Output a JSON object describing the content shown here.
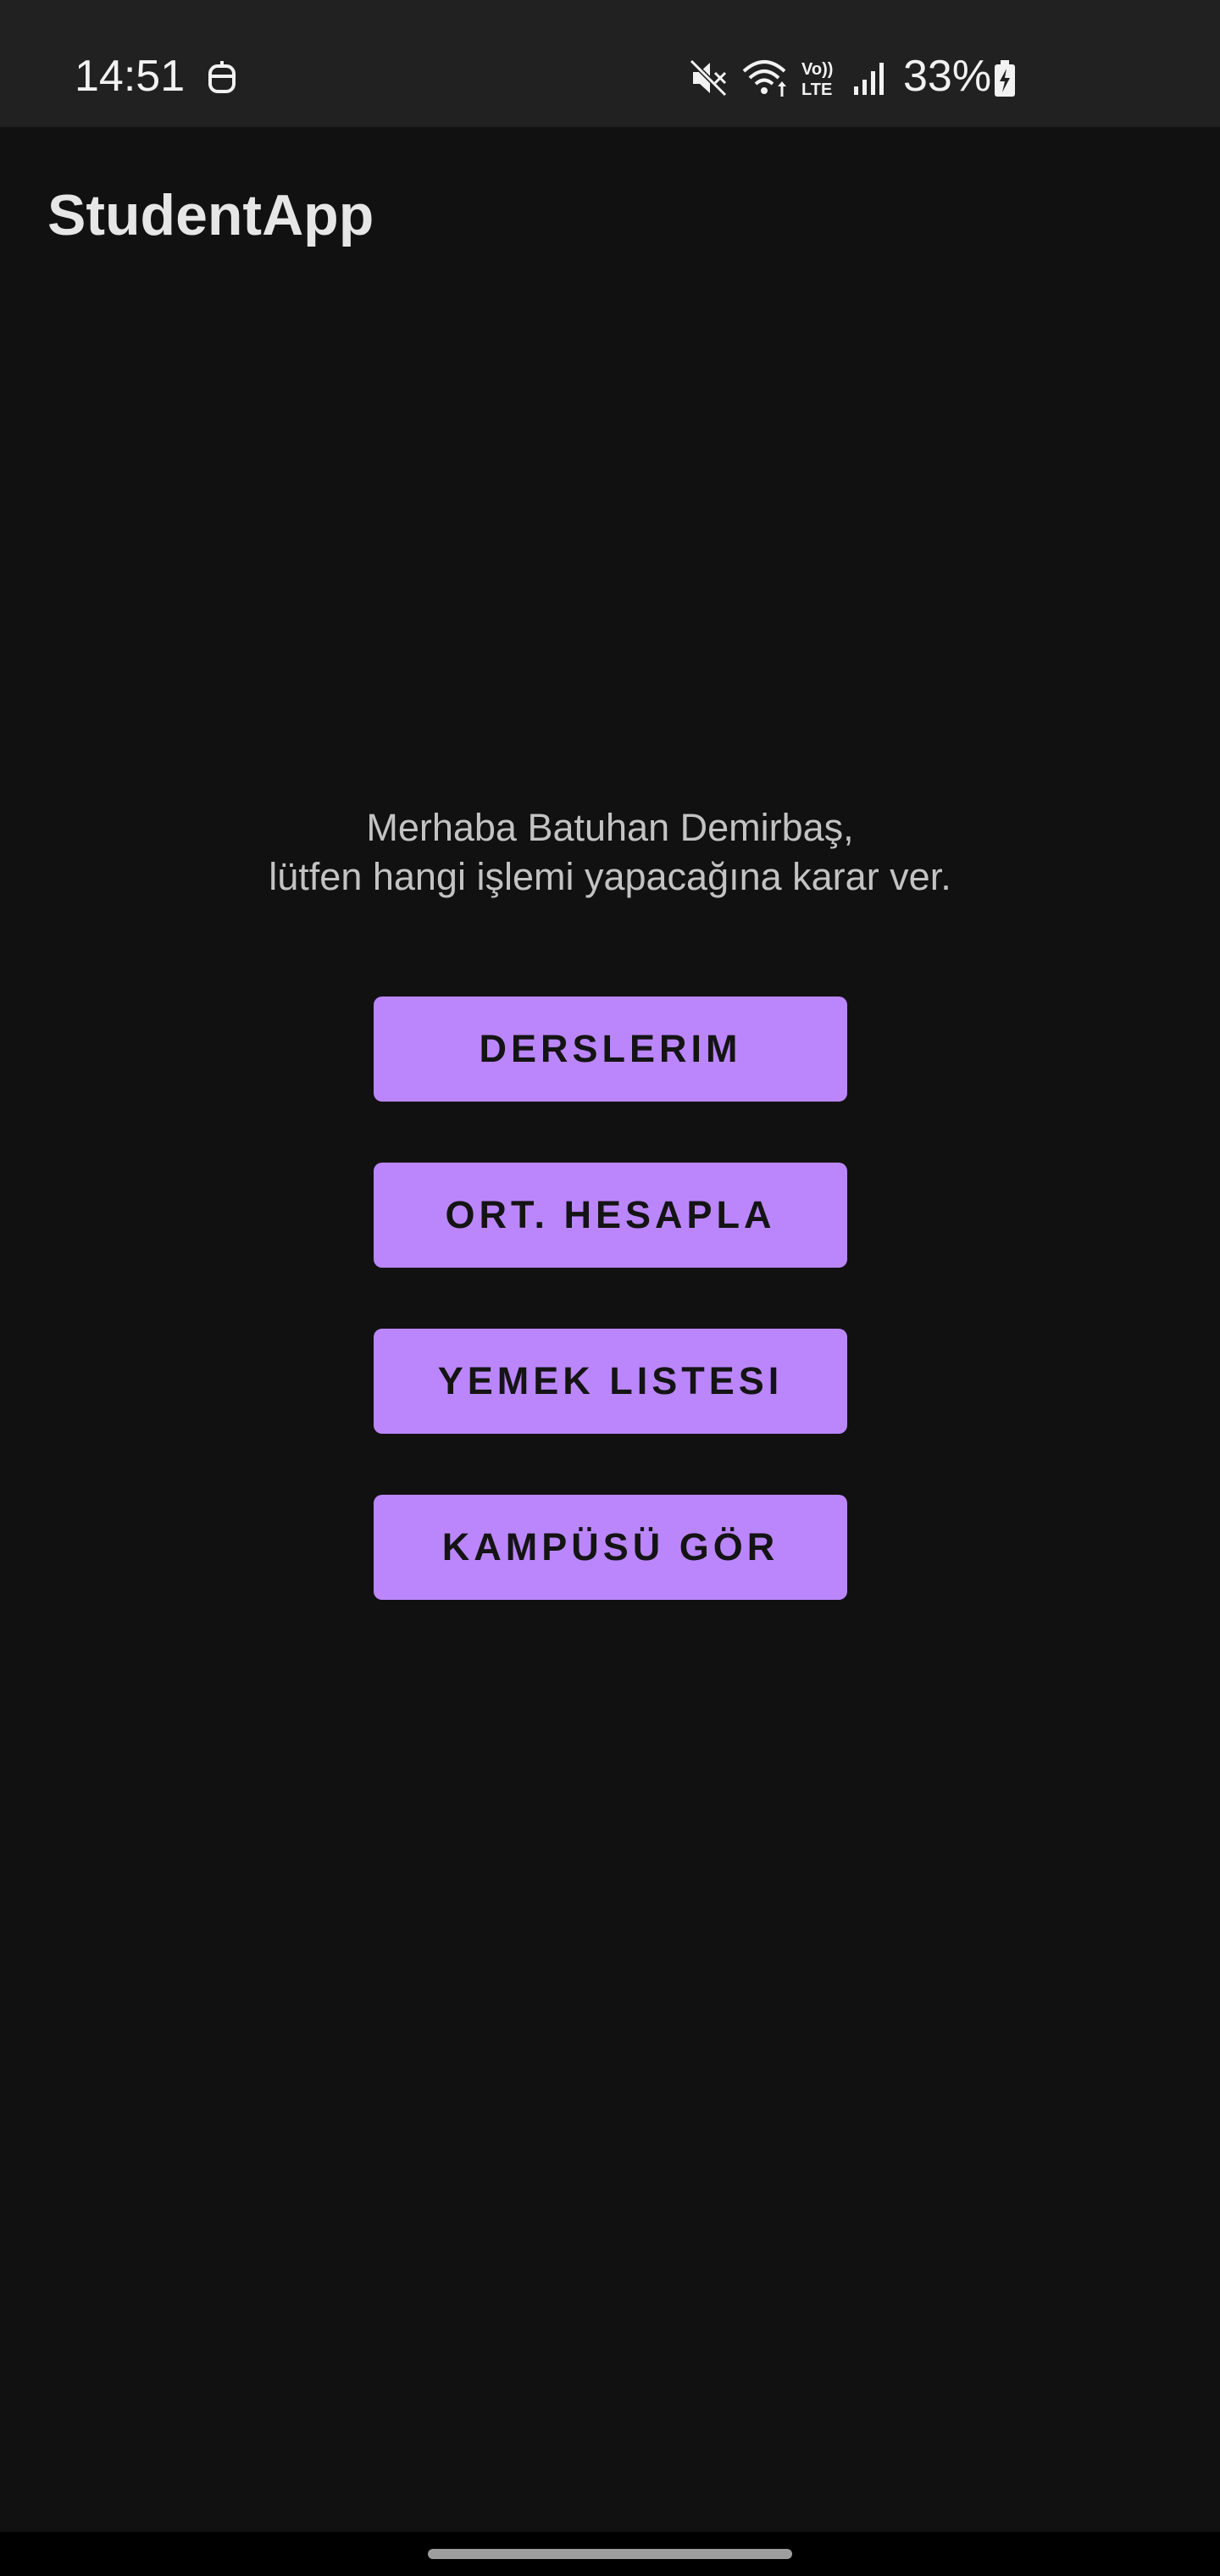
{
  "status_bar": {
    "time": "14:51",
    "battery_percent": "33%",
    "icons": [
      "notification-bot-icon",
      "mute-icon",
      "wifi-icon",
      "volte-icon",
      "signal-icon",
      "battery-charging-icon"
    ],
    "volte_top": "Vo))",
    "volte_bottom": "LTE"
  },
  "app_bar": {
    "title": "StudentApp"
  },
  "greeting": {
    "line1": "Merhaba Batuhan Demirbaş,",
    "line2": "lütfen hangi işlemi yapacağına karar ver."
  },
  "buttons": {
    "courses": "DERSLERIM",
    "average": "ORT. HESAPLA",
    "menu": "YEMEK LISTESI",
    "campus": "KAMPÜSÜ GÖR"
  },
  "colors": {
    "background": "#121112",
    "status_bar": "#212121",
    "button": "#bb86fc",
    "button_text": "#141414",
    "greeting_text": "#c3c3c3",
    "title_text": "#e6e6e6"
  }
}
